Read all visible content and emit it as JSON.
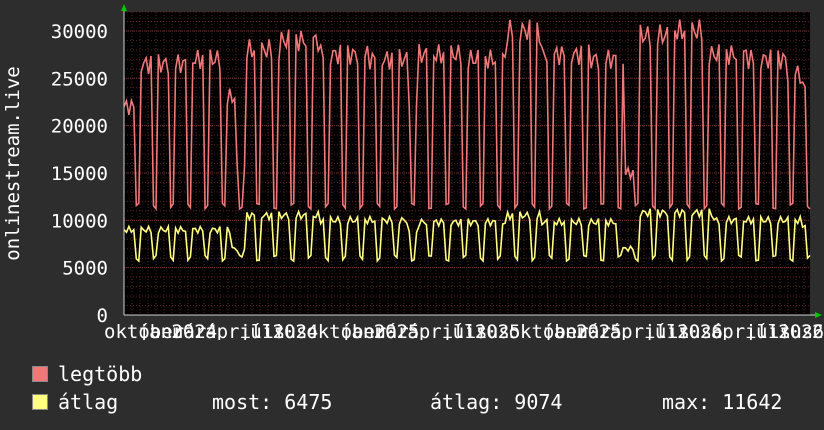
{
  "chart_data": {
    "type": "line",
    "ylabel": "onlinestream.live",
    "ylim": [
      0,
      32000
    ],
    "yticks": [
      0,
      5000,
      10000,
      15000,
      20000,
      25000,
      30000
    ],
    "ytick_labels": [
      "0",
      "5000",
      "10000",
      "15000",
      "20000",
      "25000",
      "30000"
    ],
    "xtick_labels": [
      "október",
      "január",
      "2024",
      "április",
      "július",
      "2024",
      "október",
      "január",
      "2025",
      "április",
      "július",
      "2025",
      "október",
      "január",
      "2025",
      "április",
      "július",
      "2026",
      "április",
      "július",
      "2026",
      "20"
    ],
    "grid": true,
    "series": [
      {
        "name": "legtöbb",
        "color": "#f07878",
        "level_segments": [
          [
            0,
            22000
          ],
          [
            5,
            26500
          ],
          [
            27,
            27000
          ],
          [
            42,
            23000
          ],
          [
            46,
            15500
          ],
          [
            50,
            28000
          ],
          [
            64,
            29000
          ],
          [
            80,
            27500
          ],
          [
            100,
            27000
          ],
          [
            116,
            23000
          ],
          [
            120,
            27500
          ],
          [
            140,
            27000
          ],
          [
            156,
            30000
          ],
          [
            170,
            27500
          ],
          [
            190,
            27000
          ],
          [
            204,
            15000
          ],
          [
            208,
            29500
          ],
          [
            222,
            30000
          ],
          [
            238,
            27500
          ],
          [
            254,
            27000
          ],
          [
            270,
            25500
          ],
          [
            276,
            24000
          ]
        ],
        "weekend_min": 11500
      },
      {
        "name": "átlag",
        "color": "#ffff80",
        "level_segments": [
          [
            0,
            9000
          ],
          [
            44,
            7000
          ],
          [
            50,
            10500
          ],
          [
            80,
            10000
          ],
          [
            116,
            8500
          ],
          [
            120,
            9800
          ],
          [
            156,
            10500
          ],
          [
            170,
            9800
          ],
          [
            202,
            7000
          ],
          [
            208,
            10800
          ],
          [
            240,
            10000
          ],
          [
            276,
            9500
          ]
        ],
        "weekend_min": 6000
      }
    ],
    "n_points": 280
  },
  "legend": [
    {
      "label": "legtöbb",
      "color": "#f07878"
    },
    {
      "label": "átlag",
      "color": "#ffff80"
    }
  ],
  "stats": {
    "now": "most: 6475",
    "avg": "átlag: 9074",
    "max": "max: 11642"
  },
  "colors": {
    "background": "#2d2d2d",
    "plot_background": "#000000",
    "grid": "#5a1e1e",
    "text": "#ffffff",
    "axis_arrow": "#00c800"
  }
}
